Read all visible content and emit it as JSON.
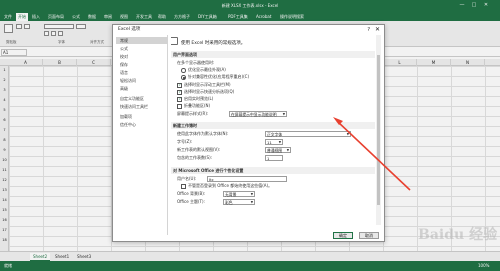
{
  "window": {
    "title": "新建 XLSX 工作表.xlsx - Excel",
    "controls": [
      "?",
      "—",
      "□",
      "✕"
    ]
  },
  "ribbon": {
    "tabs": [
      "文件",
      "开始",
      "插入",
      "页面布局",
      "公式",
      "数据",
      "审阅",
      "视图",
      "开发工具",
      "帮助",
      "方方格子",
      "DIY工具箱",
      "PDF工具集",
      "Acrobat",
      "操作说明搜索"
    ],
    "active_tab_index": 1,
    "group_labels": [
      "剪贴板",
      "字体",
      "对齐方式"
    ]
  },
  "formula_bar": {
    "name_box": "A1"
  },
  "columns": [
    "A",
    "B",
    "C",
    "D",
    "E",
    "F",
    "G",
    "H",
    "I",
    "J",
    "K",
    "L",
    "M",
    "N"
  ],
  "rows": [
    "1",
    "2",
    "3",
    "4",
    "5",
    "6",
    "7",
    "8",
    "9",
    "10",
    "11",
    "12",
    "13",
    "14",
    "15",
    "16",
    "17",
    "18"
  ],
  "sheets": [
    "Sheet2",
    "Sheet1",
    "Sheet3"
  ],
  "status": {
    "left": "就绪",
    "zoom": "100%"
  },
  "dialog": {
    "title": "Excel 选项",
    "help": "?",
    "close": "✕",
    "nav": [
      "常规",
      "公式",
      "校对",
      "保存",
      "语言",
      "轻松访问",
      "高级",
      "自定义功能区",
      "快速访问工具栏",
      "加载项",
      "信任中心"
    ],
    "nav_active_index": 0,
    "lead": "使用 Excel 时采用的常规选项。",
    "sections": {
      "ui": "用户界面选项",
      "new_wb": "新建工作簿时",
      "personal": "对 Microsoft Office 进行个性化设置"
    },
    "ui_options": {
      "multi_display_label": "在多个显示器使用时:",
      "radio1": "优化显示最佳外观(A)",
      "radio2": "针对兼容性优化(应用程序重启)(C)",
      "cb1": "选择时显示浮动工具栏(M)",
      "cb2": "选择时显示快速分析选项(Q)",
      "cb3": "启用实时预览(L)",
      "cb4": "折叠功能区(N)",
      "tooltip_label": "屏幕提示样式(R):",
      "tooltip_value": "在屏幕提示中显示功能说明"
    },
    "new_wb_options": {
      "font_label": "使用此字体作为默认字体(N):",
      "font_value": "正文字体",
      "size_label": "字号(Z):",
      "size_value": "11",
      "view_label": "新工作表的默认视图(V):",
      "view_value": "普通视图",
      "sheets_label": "包含的工作表数(S):",
      "sheets_value": "1"
    },
    "personal_options": {
      "user_label": "用户名(U):",
      "user_value": "Itc",
      "always_label": "不管是否登录到 Office 都始终使用这些值(A)。",
      "bg_label": "Office 背景(B):",
      "bg_value": "无背景",
      "theme_label": "Office 主题(T):",
      "theme_value": "彩色"
    },
    "buttons": {
      "ok": "确定",
      "cancel": "取消"
    }
  },
  "colors": {
    "excel_green": "#217346",
    "arrow_red": "#e8402f"
  },
  "watermark": "Baidu 经验"
}
